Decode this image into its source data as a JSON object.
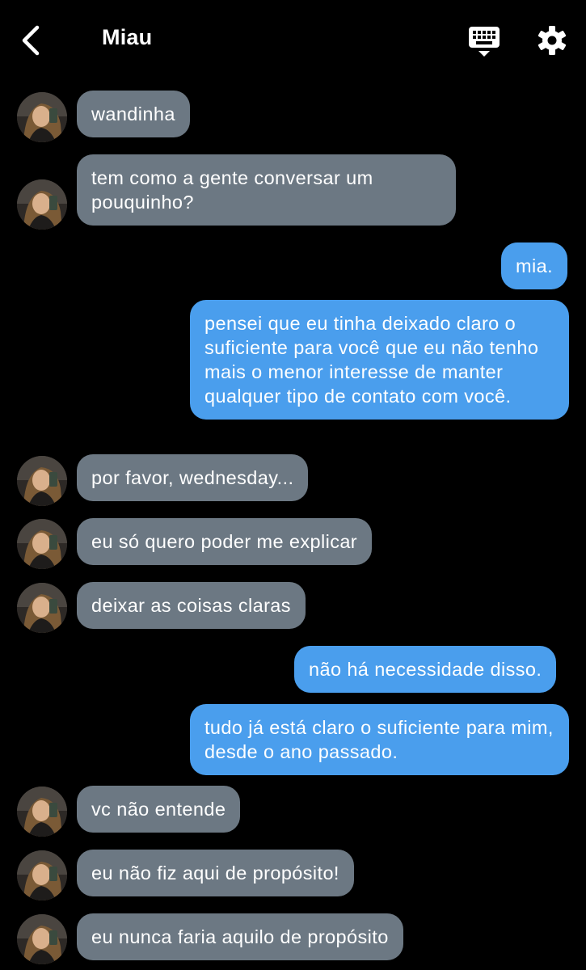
{
  "header": {
    "title": "Miau",
    "back_icon": "chevron-left-icon",
    "keyboard_icon": "keyboard-icon",
    "settings_icon": "gear-icon"
  },
  "colors": {
    "background": "#000000",
    "incoming_bubble": "#6c7883",
    "outgoing_bubble": "#4a9eed"
  },
  "messages": [
    {
      "side": "in",
      "text": "wandinha"
    },
    {
      "side": "in",
      "text": "tem como a gente conversar um pouquinho?"
    },
    {
      "side": "out",
      "text": "mia."
    },
    {
      "side": "out",
      "text": "pensei que eu tinha deixado claro o suficiente para você que eu não tenho mais o menor interesse de manter qualquer tipo de contato com você."
    },
    {
      "side": "in",
      "text": "por favor, wednesday..."
    },
    {
      "side": "in",
      "text": "eu só quero poder me explicar"
    },
    {
      "side": "in",
      "text": "deixar as coisas claras"
    },
    {
      "side": "out",
      "text": "não há necessidade disso."
    },
    {
      "side": "out",
      "text": "tudo já está claro o suficiente para mim, desde o ano passado."
    },
    {
      "side": "in",
      "text": "vc não entende"
    },
    {
      "side": "in",
      "text": "eu não fiz aqui de propósito!"
    },
    {
      "side": "in",
      "text": "eu nunca faria aquilo de propósito"
    }
  ]
}
